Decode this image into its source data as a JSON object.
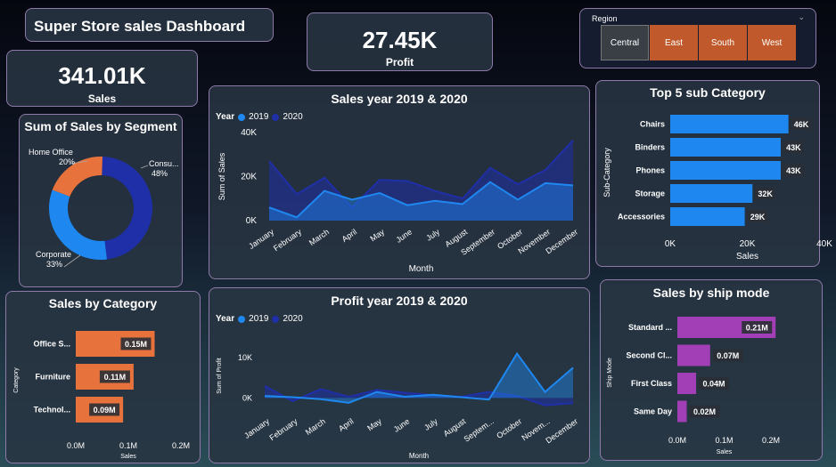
{
  "dashboard": {
    "title": "Super Store sales Dashboard"
  },
  "kpi_sales": {
    "value": "341.01K",
    "label": "Sales"
  },
  "kpi_profit": {
    "value": "27.45K",
    "label": "Profit"
  },
  "region": {
    "label": "Region",
    "options": [
      "Central",
      "East",
      "South",
      "West"
    ],
    "selected_color": "#c05a2c"
  },
  "colors": {
    "blue": "#1e88f0",
    "navy": "#1f2fa8",
    "orange": "#e8723c",
    "purple": "#9a38b0",
    "ship_purple": "#a23fb6"
  },
  "legend": {
    "title": "Year",
    "y2019": "2019",
    "y2020": "2020"
  },
  "chart_data": [
    {
      "id": "segment",
      "type": "pie",
      "title": "Sum of Sales by Segment",
      "slices": [
        {
          "name": "Consu...",
          "pct": 48,
          "label": "48%",
          "color": "#1f2fa8"
        },
        {
          "name": "Corporate",
          "pct": 33,
          "label": "33%",
          "color": "#1e88f0"
        },
        {
          "name": "Home Office",
          "pct": 20,
          "label": "20%",
          "color": "#e8723c"
        }
      ]
    },
    {
      "id": "sales_year",
      "type": "area",
      "title": "Sales year 2019 & 2020",
      "xlabel": "Month",
      "ylabel": "Sum of Sales",
      "categories": [
        "January",
        "February",
        "March",
        "April",
        "May",
        "June",
        "July",
        "August",
        "September",
        "October",
        "November",
        "December"
      ],
      "yticks": [
        "0K",
        "20K",
        "40K"
      ],
      "ylim": [
        0,
        40000
      ],
      "series": [
        {
          "name": "2019",
          "values": [
            6000,
            1500,
            13500,
            9500,
            12500,
            7000,
            9000,
            7500,
            17500,
            9500,
            17000,
            16000
          ]
        },
        {
          "name": "2020",
          "values": [
            27000,
            12000,
            19500,
            6000,
            18500,
            18000,
            13500,
            10000,
            24000,
            16500,
            23000,
            36500
          ]
        }
      ]
    },
    {
      "id": "subcat",
      "type": "bar",
      "title": "Top 5 sub Category",
      "xlabel": "Sales",
      "ylabel": "Sub-Category",
      "categories": [
        "Chairs",
        "Binders",
        "Phones",
        "Storage",
        "Accessories"
      ],
      "values": [
        46,
        43,
        43,
        32,
        29
      ],
      "data_labels": [
        "46K",
        "43K",
        "43K",
        "32K",
        "29K"
      ],
      "xticks": [
        "0K",
        "20K",
        "40K"
      ],
      "xlim": [
        0,
        60
      ]
    },
    {
      "id": "category",
      "type": "bar",
      "title": "Sales by Category",
      "xlabel": "Sales",
      "ylabel": "Category",
      "categories": [
        "Office S...",
        "Furniture",
        "Technol..."
      ],
      "values": [
        0.15,
        0.11,
        0.09
      ],
      "data_labels": [
        "0.15M",
        "0.11M",
        "0.09M"
      ],
      "xticks": [
        "0.0M",
        "0.1M",
        "0.2M"
      ],
      "xlim": [
        0,
        0.2
      ]
    },
    {
      "id": "profit_year",
      "type": "area",
      "title": "Profit year 2019 & 2020",
      "xlabel": "Month",
      "ylabel": "Sum of Profit",
      "categories": [
        "January",
        "February",
        "March",
        "April",
        "May",
        "June",
        "July",
        "August",
        "Septem...",
        "October",
        "Novem...",
        "December"
      ],
      "yticks": [
        "0K",
        "10K"
      ],
      "ylim": [
        -3000,
        14000
      ],
      "series": [
        {
          "name": "2019",
          "values": [
            500,
            200,
            -300,
            -1200,
            1500,
            300,
            800,
            200,
            -400,
            11000,
            1500,
            7500
          ]
        },
        {
          "name": "2020",
          "values": [
            3000,
            -800,
            2200,
            300,
            2000,
            1300,
            700,
            300,
            1500,
            500,
            -1800,
            -1300
          ]
        }
      ]
    },
    {
      "id": "shipmode",
      "type": "bar",
      "title": "Sales by ship mode",
      "xlabel": "Sales",
      "ylabel": "Ship Mode",
      "categories": [
        "Standard ...",
        "Second Cl...",
        "First Class",
        "Same Day"
      ],
      "values": [
        0.21,
        0.07,
        0.04,
        0.02
      ],
      "data_labels": [
        "0.21M",
        "0.07M",
        "0.04M",
        "0.02M"
      ],
      "xticks": [
        "0.0M",
        "0.1M",
        "0.2M"
      ],
      "xlim": [
        0,
        0.2
      ]
    }
  ]
}
